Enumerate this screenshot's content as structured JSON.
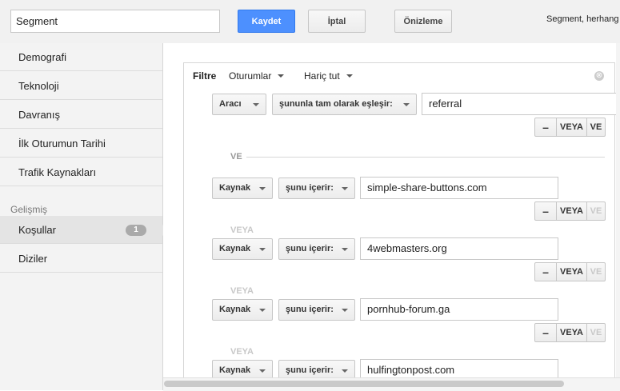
{
  "topbar": {
    "segment_name_value": "Segment",
    "save_label": "Kaydet",
    "cancel_label": "İptal",
    "preview_label": "Önizleme",
    "summary_text": "Segment, herhang"
  },
  "sidebar": {
    "items": [
      {
        "label": "Demografi"
      },
      {
        "label": "Teknoloji"
      },
      {
        "label": "Davranış"
      },
      {
        "label": "İlk Oturumun Tarihi"
      },
      {
        "label": "Trafik Kaynakları"
      }
    ],
    "advanced_heading": "Gelişmiş",
    "advanced_items": [
      {
        "label": "Koşullar",
        "badge": "1"
      },
      {
        "label": "Diziler"
      }
    ]
  },
  "filter": {
    "title": "Filtre",
    "scope": "Oturumlar",
    "mode": "Hariç tut",
    "close_symbol": "⊗",
    "and_label": "VE",
    "or_label": "VEYA",
    "minus_label": "–",
    "or_button": "VEYA",
    "and_button": "VE",
    "conditions": [
      {
        "dimension": "Aracı",
        "operator": "şununla tam olarak eşleşir:",
        "value": "referral"
      },
      {
        "dimension": "Kaynak",
        "operator": "şunu içerir:",
        "value": "simple-share-buttons.com"
      },
      {
        "dimension": "Kaynak",
        "operator": "şunu içerir:",
        "value": "4webmasters.org"
      },
      {
        "dimension": "Kaynak",
        "operator": "şunu içerir:",
        "value": "pornhub-forum.ga"
      },
      {
        "dimension": "Kaynak",
        "operator": "şunu içerir:",
        "value": "hulfingtonpost.com"
      }
    ]
  }
}
